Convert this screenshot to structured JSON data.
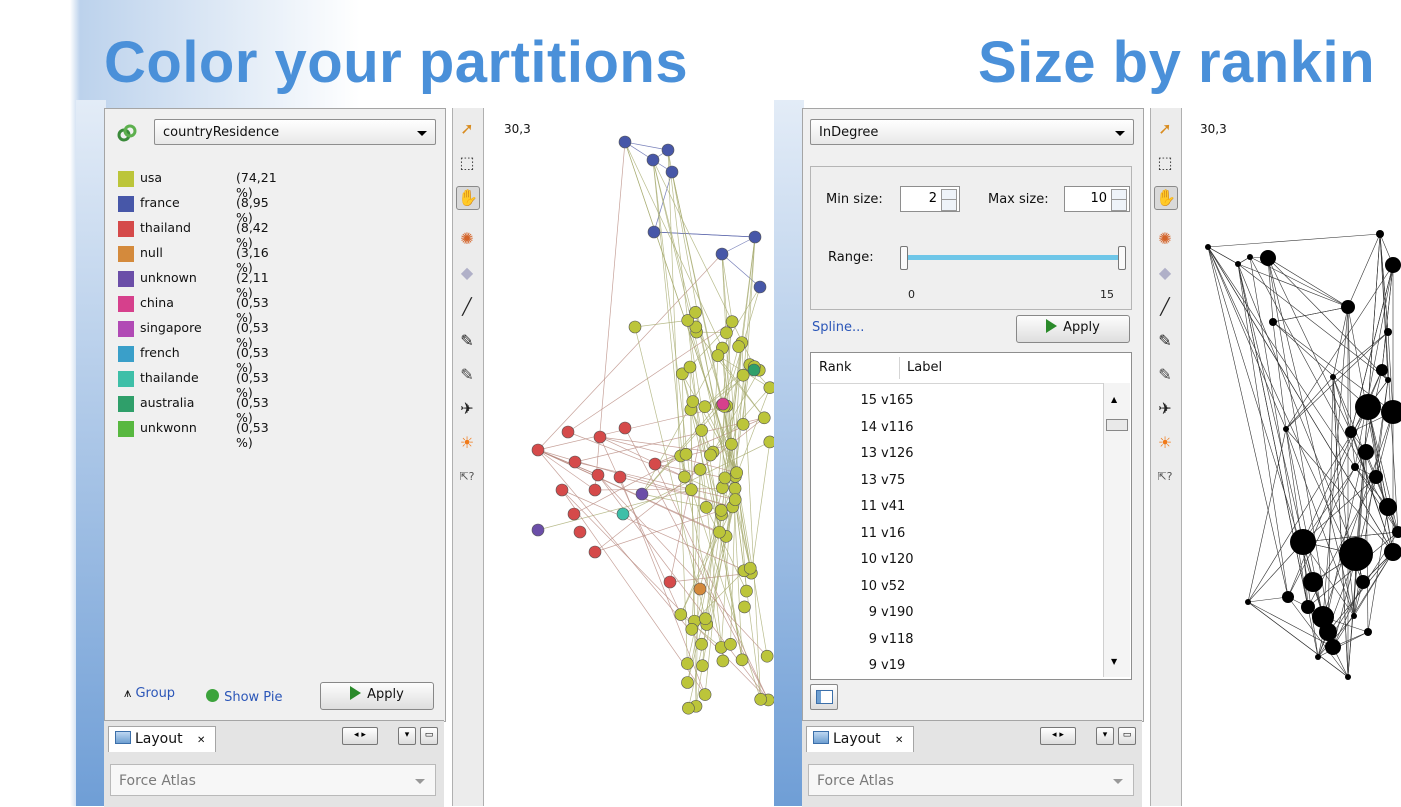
{
  "left": {
    "title": "Color your partitions",
    "partition_combo": "countryResidence",
    "legend": [
      {
        "name": "usa",
        "pct": "(74,21 %)",
        "color": "#bcc53a"
      },
      {
        "name": "france",
        "pct": "(8,95 %)",
        "color": "#4757a8"
      },
      {
        "name": "thailand",
        "pct": "(8,42 %)",
        "color": "#d54a4a"
      },
      {
        "name": "null",
        "pct": "(3,16 %)",
        "color": "#d48a3c"
      },
      {
        "name": "unknown",
        "pct": "(2,11 %)",
        "color": "#6b4ea8"
      },
      {
        "name": "china",
        "pct": "(0,53 %)",
        "color": "#d6408c"
      },
      {
        "name": "singapore",
        "pct": "(0,53 %)",
        "color": "#b14ab5"
      },
      {
        "name": "french",
        "pct": "(0,53 %)",
        "color": "#3a9fc9"
      },
      {
        "name": "thailande",
        "pct": "(0,53 %)",
        "color": "#3ebfa8"
      },
      {
        "name": "australia",
        "pct": "(0,53 %)",
        "color": "#2f9f6a"
      },
      {
        "name": "unkwonn",
        "pct": "(0,53 %)",
        "color": "#58b840"
      }
    ],
    "group_label": "Group",
    "show_pie_label": "Show Pie",
    "apply_label": "Apply",
    "coords": "30,3",
    "layout_tab": "Layout",
    "layout_combo": "Force Atlas"
  },
  "right": {
    "title": "Size by rankin",
    "ranking_combo": "InDegree",
    "min_size_label": "Min size:",
    "min_size_value": "2",
    "max_size_label": "Max size:",
    "max_size_value": "10",
    "range_label": "Range:",
    "range_min": "0",
    "range_max": "15",
    "spline_label": "Spline...",
    "apply_label": "Apply",
    "table_headers": [
      "Rank",
      "Label"
    ],
    "table_rows": [
      {
        "rank": "15",
        "label": "v165"
      },
      {
        "rank": "14",
        "label": "v116"
      },
      {
        "rank": "13",
        "label": "v126"
      },
      {
        "rank": "13",
        "label": "v75"
      },
      {
        "rank": "11",
        "label": "v41"
      },
      {
        "rank": "11",
        "label": "v16"
      },
      {
        "rank": "10",
        "label": "v120"
      },
      {
        "rank": "10",
        "label": "v52"
      },
      {
        "rank": "9",
        "label": "v190"
      },
      {
        "rank": "9",
        "label": "v118"
      },
      {
        "rank": "9",
        "label": "v19"
      }
    ],
    "coords": "30,3",
    "layout_tab": "Layout",
    "layout_combo": "Force Atlas"
  },
  "toolbar_icons": [
    "pointer-icon",
    "rectangle-select-icon",
    "drag-hand-icon",
    "painter-icon",
    "diamond-icon",
    "brush-icon",
    "pencil-icon",
    "edge-pencil-icon",
    "airplane-icon",
    "sun-icon",
    "help-cursor-icon"
  ]
}
